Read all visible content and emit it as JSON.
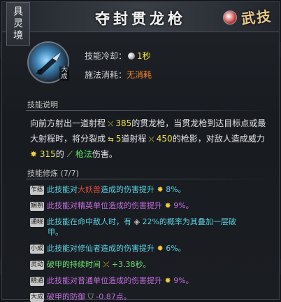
{
  "window": {
    "title": "夺封贯龙枪"
  },
  "realm_tag": [
    "具",
    "灵",
    "境"
  ],
  "badge": {
    "text": "武技",
    "icon": "wuji-emblem-icon"
  },
  "skill": {
    "icon": "spear-skill-icon",
    "rank": "大成",
    "cooldown_label": "技能冷却：",
    "cooldown_value": "1秒",
    "cost_label": "施法消耗：",
    "cost_value": "无消耗"
  },
  "description": {
    "heading": "技能说明",
    "t1": "向前方射出一道射程",
    "v1": "385",
    "t2": "的贯龙枪，当贯龙枪到达目标点或最大射程时，将分裂成",
    "v2": "5",
    "t3": "道射程",
    "v3": "450",
    "t4": "的枪影，对敌人造成威力",
    "v4": "315",
    "t5": "的",
    "v5": "枪法",
    "t6": "伤害。"
  },
  "mods_heading": "技能修炼 (7/7)",
  "mods": [
    {
      "tag": "乍练",
      "a": "此技能对",
      "b": "大妖兽",
      "c": "造成的伤害提升",
      "d": "8%。"
    },
    {
      "tag": "娴熟",
      "a": "此技能对精英单位造成的伤害提升",
      "d": "9%。"
    },
    {
      "tag": "通晓",
      "a": "此技能在命中敌人时，有",
      "d": "22%的概率为其叠加一层破",
      "e": "甲。"
    },
    {
      "tag": "小成",
      "a": "此技能对修仙者造成的伤害提升",
      "d": "6%。"
    },
    {
      "tag": "灵动",
      "a": "破甲的持续时间",
      "d": "+3.38秒。"
    },
    {
      "tag": "精通",
      "a": "此技能对普通单位造成的伤害提升",
      "d": "9%。"
    },
    {
      "tag": "大成",
      "a": "破甲的防御",
      "d": "-0.87点。"
    }
  ],
  "colors": {
    "yellow": "#f0e24a",
    "green": "#5fe36a",
    "cyan": "#58d6e6",
    "purple": "#c56ee0",
    "red": "#e64a3a",
    "orange": "#ff8a2a"
  }
}
